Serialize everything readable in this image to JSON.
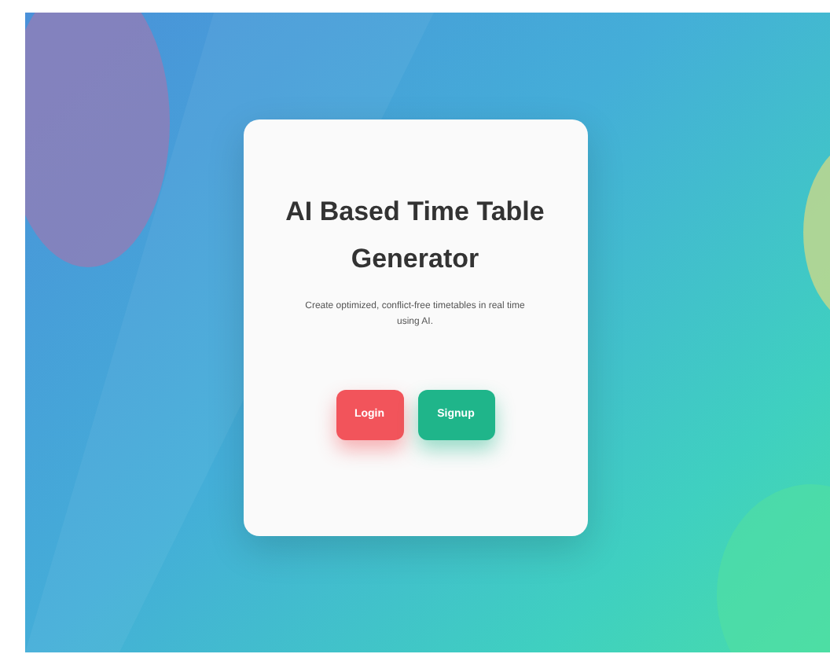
{
  "card": {
    "title": "AI Based Time Table Generator",
    "description": "Create optimized, conflict-free timetables in real time using AI."
  },
  "buttons": [
    {
      "label": "Login",
      "kind": "login"
    },
    {
      "label": "Signup",
      "kind": "signup"
    }
  ]
}
